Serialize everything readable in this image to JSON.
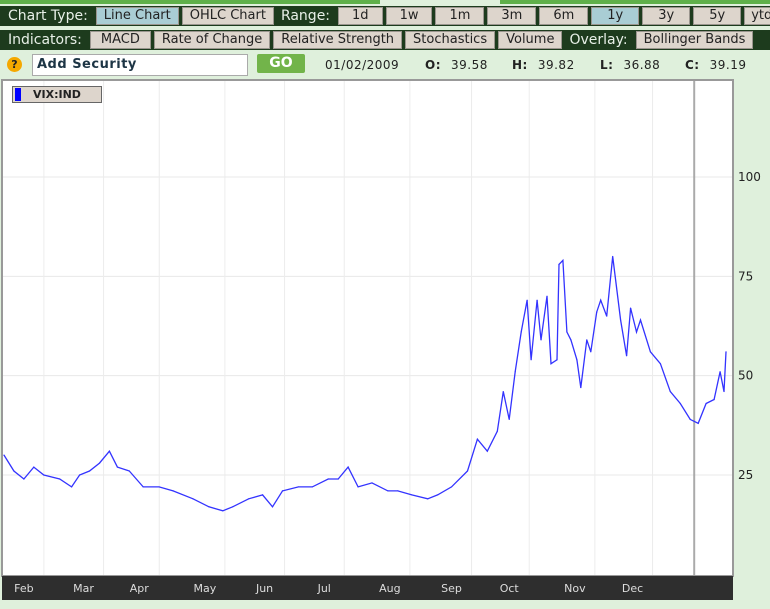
{
  "toolbar": {
    "chart_type_label": "Chart Type:",
    "chart_types": [
      "Line Chart",
      "OHLC Chart"
    ],
    "range_label": "Range:",
    "ranges": [
      "1d",
      "1w",
      "1m",
      "3m",
      "6m",
      "1y",
      "3y",
      "5y",
      "ytd"
    ],
    "indicators_label": "Indicators:",
    "indicators": [
      "MACD",
      "Rate of Change",
      "Relative Strength",
      "Stochastics",
      "Volume"
    ],
    "overlay_label": "Overlay:",
    "overlays": [
      "Bollinger Bands"
    ]
  },
  "security": {
    "help": "?",
    "placeholder": "Add Security",
    "go": "GO"
  },
  "quote": {
    "date": "01/02/2009",
    "o_label": "O:",
    "o": "39.58",
    "h_label": "H:",
    "h": "39.82",
    "l_label": "L:",
    "l": "36.88",
    "c_label": "C:",
    "c": "39.19"
  },
  "colors": {
    "line": "#3333ff",
    "accent": "#1d3b1d",
    "selected": "#a9cdd4"
  },
  "chart_data": {
    "type": "line",
    "title": "",
    "legend": [
      {
        "name": "VIX:IND",
        "color": "#0000ff"
      }
    ],
    "legend_placement": "top-left",
    "xlabel": "",
    "ylabel": "",
    "x_unit": "days since start of range",
    "xlim": [
      0,
      366
    ],
    "ylim": [
      0,
      125
    ],
    "yticks": [
      25,
      50,
      75,
      100
    ],
    "xticks": [
      {
        "label": "Feb",
        "x": 10
      },
      {
        "label": "Mar",
        "x": 40
      },
      {
        "label": "Apr",
        "x": 68
      },
      {
        "label": "May",
        "x": 101
      },
      {
        "label": "Jun",
        "x": 131
      },
      {
        "label": "Jul",
        "x": 161
      },
      {
        "label": "Aug",
        "x": 194
      },
      {
        "label": "Sep",
        "x": 225
      },
      {
        "label": "Oct",
        "x": 254
      },
      {
        "label": "Nov",
        "x": 287
      },
      {
        "label": "Dec",
        "x": 316
      }
    ],
    "year_divider_x": 347,
    "grid": true,
    "series": [
      {
        "name": "VIX:IND",
        "points": [
          [
            0,
            30
          ],
          [
            5,
            26
          ],
          [
            10,
            24
          ],
          [
            15,
            27
          ],
          [
            20,
            25
          ],
          [
            28,
            24
          ],
          [
            34,
            22
          ],
          [
            38,
            25
          ],
          [
            43,
            26
          ],
          [
            48,
            28
          ],
          [
            53,
            31
          ],
          [
            57,
            27
          ],
          [
            63,
            26
          ],
          [
            70,
            22
          ],
          [
            78,
            22
          ],
          [
            85,
            21
          ],
          [
            95,
            19
          ],
          [
            103,
            17
          ],
          [
            110,
            16
          ],
          [
            115,
            17
          ],
          [
            123,
            19
          ],
          [
            130,
            20
          ],
          [
            135,
            17
          ],
          [
            140,
            21
          ],
          [
            148,
            22
          ],
          [
            155,
            22
          ],
          [
            163,
            24
          ],
          [
            168,
            24
          ],
          [
            173,
            27
          ],
          [
            178,
            22
          ],
          [
            185,
            23
          ],
          [
            193,
            21
          ],
          [
            198,
            21
          ],
          [
            205,
            20
          ],
          [
            213,
            19
          ],
          [
            218,
            20
          ],
          [
            225,
            22
          ],
          [
            233,
            26
          ],
          [
            238,
            34
          ],
          [
            243,
            31
          ],
          [
            248,
            36
          ],
          [
            251,
            46
          ],
          [
            254,
            39
          ],
          [
            257,
            51
          ],
          [
            260,
            61
          ],
          [
            263,
            69
          ],
          [
            265,
            54
          ],
          [
            268,
            69
          ],
          [
            270,
            59
          ],
          [
            273,
            70
          ],
          [
            275,
            53
          ],
          [
            278,
            54
          ],
          [
            279,
            78
          ],
          [
            281,
            79
          ],
          [
            283,
            61
          ],
          [
            285,
            59
          ],
          [
            288,
            54
          ],
          [
            290,
            47
          ],
          [
            293,
            59
          ],
          [
            295,
            56
          ],
          [
            298,
            66
          ],
          [
            300,
            69
          ],
          [
            303,
            65
          ],
          [
            306,
            80
          ],
          [
            310,
            64
          ],
          [
            313,
            55
          ],
          [
            315,
            67
          ],
          [
            318,
            61
          ],
          [
            320,
            64
          ],
          [
            325,
            56
          ],
          [
            330,
            53
          ],
          [
            335,
            46
          ],
          [
            340,
            43
          ],
          [
            345,
            39
          ],
          [
            349,
            38
          ],
          [
            353,
            43
          ],
          [
            357,
            44
          ],
          [
            360,
            51
          ],
          [
            362,
            46
          ],
          [
            363,
            56
          ]
        ]
      }
    ]
  }
}
